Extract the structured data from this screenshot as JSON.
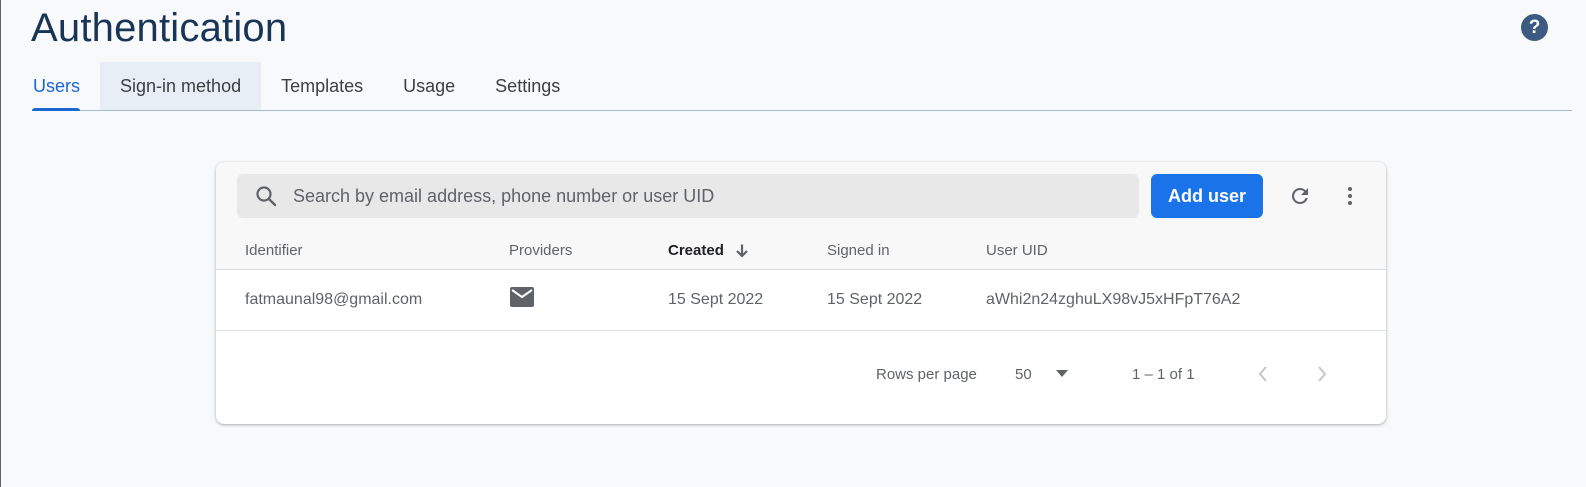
{
  "page": {
    "title": "Authentication",
    "help_icon": "help-circle-icon",
    "help_glyph": "?"
  },
  "tabs": [
    {
      "label": "Users",
      "active": true
    },
    {
      "label": "Sign-in method",
      "active": false
    },
    {
      "label": "Templates",
      "active": false
    },
    {
      "label": "Usage",
      "active": false
    },
    {
      "label": "Settings",
      "active": false
    }
  ],
  "search": {
    "placeholder": "Search by email address, phone number or user UID",
    "value": ""
  },
  "toolbar": {
    "add_user_label": "Add user",
    "refresh_icon": "refresh-icon",
    "more_icon": "more-vert-icon"
  },
  "table": {
    "columns": [
      "Identifier",
      "Providers",
      "Created",
      "Signed in",
      "User UID"
    ],
    "sorted_column": "Created",
    "rows": [
      {
        "identifier": "fatmaunal98@gmail.com",
        "provider_icon": "email-icon",
        "created": "15 Sept 2022",
        "signed_in": "15 Sept 2022",
        "uid": "aWhi2n24zghuLX98vJ5xHFpT76A2"
      }
    ]
  },
  "pagination": {
    "rows_per_page_label": "Rows per page",
    "rows_per_page_value": "50",
    "range_label": "1 – 1 of 1"
  },
  "colors": {
    "accent": "#1a73e8",
    "title": "#1a3458",
    "active_tab": "#1967d2"
  }
}
